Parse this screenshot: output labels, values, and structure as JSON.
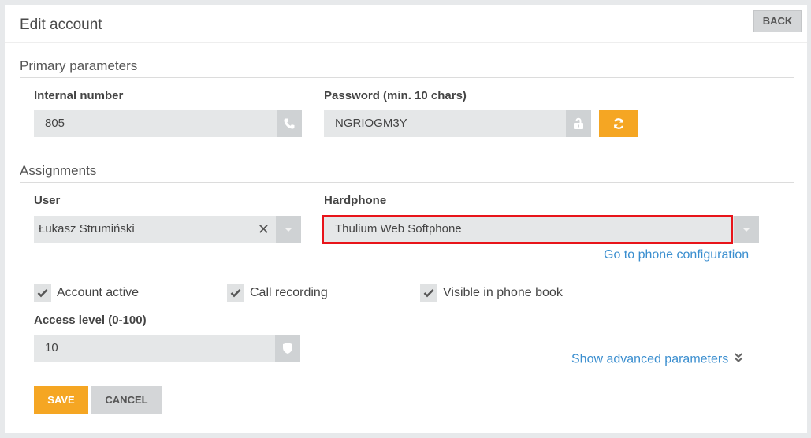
{
  "header": {
    "title": "Edit account",
    "back_label": "BACK"
  },
  "primary": {
    "title": "Primary parameters",
    "internal_number": {
      "label": "Internal number",
      "value": "805"
    },
    "password": {
      "label": "Password (min. 10 chars)",
      "value": "NGRIOGM3Y"
    }
  },
  "assignments": {
    "title": "Assignments",
    "user": {
      "label": "User",
      "value": "Łukasz Strumiński"
    },
    "hardphone": {
      "label": "Hardphone",
      "value": "Thulium Web Softphone",
      "link": "Go to phone configuration"
    }
  },
  "checkboxes": [
    {
      "label": "Account active",
      "checked": true
    },
    {
      "label": "Call recording",
      "checked": true
    },
    {
      "label": "Visible in phone book",
      "checked": true
    }
  ],
  "access_level": {
    "label": "Access level (0-100)",
    "value": "10"
  },
  "advanced_link": "Show advanced parameters",
  "actions": {
    "save_label": "SAVE",
    "cancel_label": "CANCEL"
  },
  "colors": {
    "accent": "#f5a623",
    "link": "#3a8ecf",
    "highlight": "#e8141a"
  }
}
